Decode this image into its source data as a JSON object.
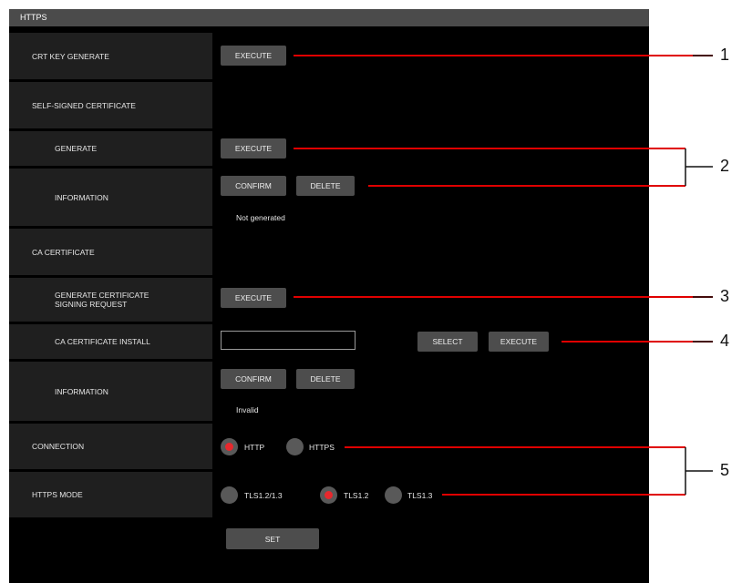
{
  "header": {
    "title": "HTTPS"
  },
  "sections": {
    "crt_key": {
      "label": "CRT KEY GENERATE",
      "execute": "EXECUTE"
    },
    "self_signed": {
      "label": "SELF-SIGNED CERTIFICATE",
      "generate": {
        "label": "GENERATE",
        "execute": "EXECUTE"
      },
      "information": {
        "label": "INFORMATION",
        "confirm": "CONFIRM",
        "delete": "DELETE",
        "status": "Not generated"
      }
    },
    "ca": {
      "label": "CA CERTIFICATE",
      "csr": {
        "label": "GENERATE CERTIFICATE\nSIGNING REQUEST",
        "execute": "EXECUTE"
      },
      "install": {
        "label": "CA CERTIFICATE INSTALL",
        "file_value": "",
        "select": "SELECT",
        "execute": "EXECUTE"
      },
      "information": {
        "label": "INFORMATION",
        "confirm": "CONFIRM",
        "delete": "DELETE",
        "status": "Invalid"
      }
    },
    "connection": {
      "label": "CONNECTION",
      "options": [
        {
          "label": "HTTP",
          "selected": true
        },
        {
          "label": "HTTPS",
          "selected": false
        }
      ]
    },
    "https_mode": {
      "label": "HTTPS MODE",
      "options": [
        {
          "label": "TLS1.2/1.3",
          "selected": false
        },
        {
          "label": "TLS1.2",
          "selected": true
        },
        {
          "label": "TLS1.3",
          "selected": false
        }
      ]
    }
  },
  "set_button": "SET",
  "callouts": [
    "1",
    "2",
    "3",
    "4",
    "5"
  ],
  "colors": {
    "accent": "#e8282d",
    "panel": "#000000",
    "label_bg": "#1f1f1f",
    "button": "#4d4d4d",
    "callout": "#e00000"
  }
}
